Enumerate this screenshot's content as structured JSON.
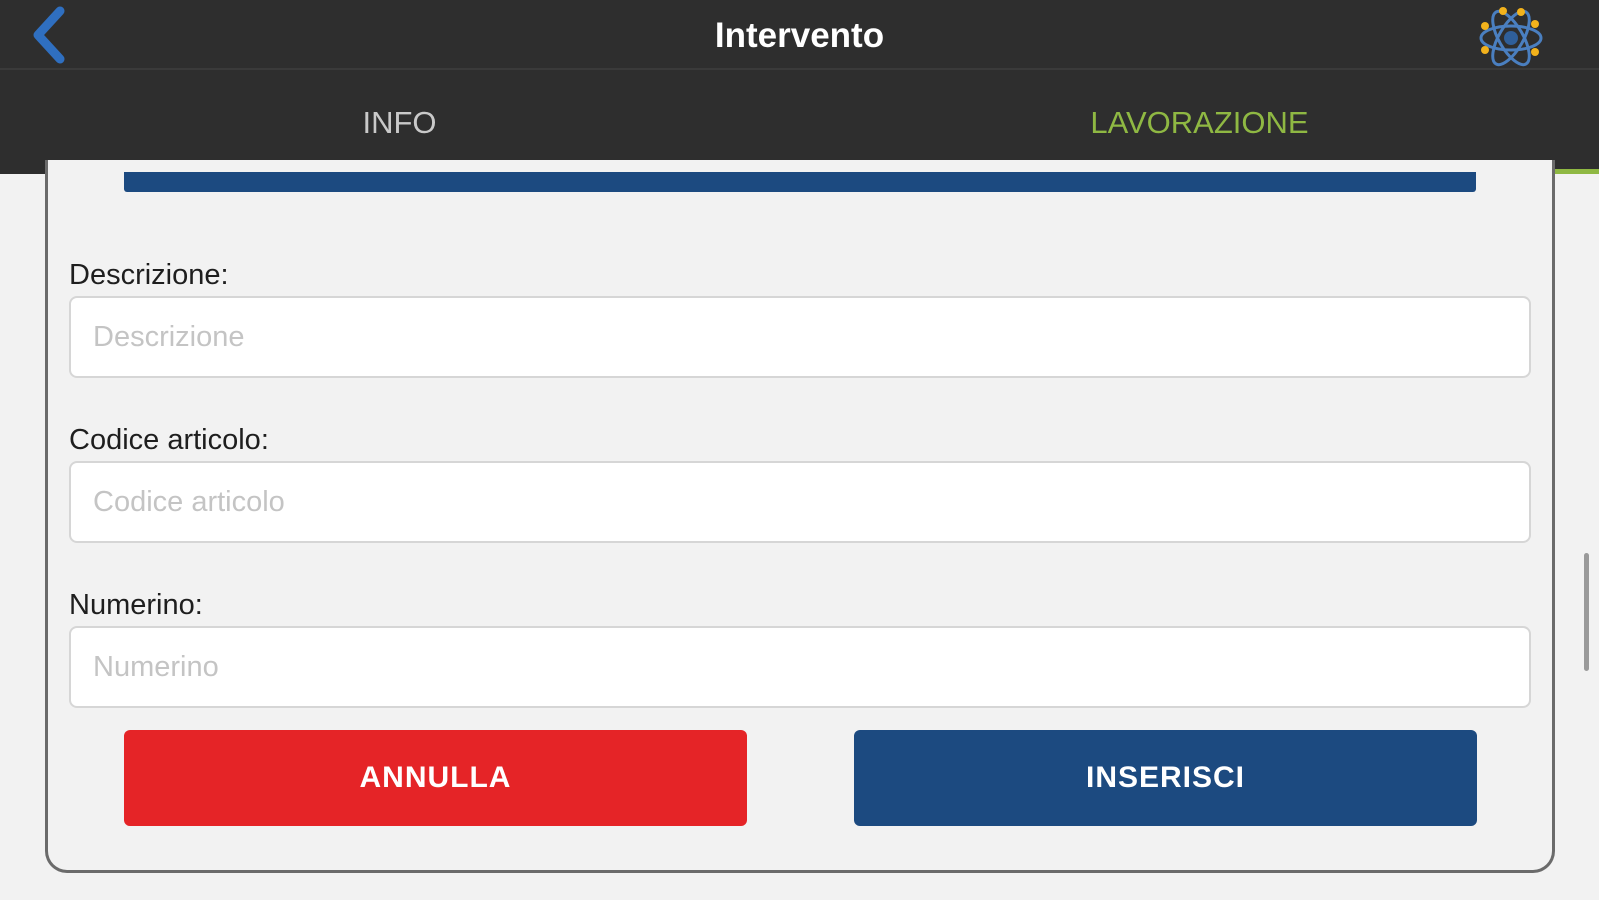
{
  "header": {
    "title": "Intervento",
    "back_icon": "chevron-left-icon",
    "logo_icon": "atom-logo-icon",
    "back_color": "#2f6fc0"
  },
  "tabs": [
    {
      "label": "INFO",
      "active": false
    },
    {
      "label": "LAVORAZIONE",
      "active": true
    }
  ],
  "form": {
    "descrizione": {
      "label": "Descrizione:",
      "placeholder": "Descrizione",
      "value": ""
    },
    "codice_articolo": {
      "label": "Codice articolo:",
      "placeholder": "Codice articolo",
      "value": ""
    },
    "numerino": {
      "label": "Numerino:",
      "placeholder": "Numerino",
      "value": ""
    }
  },
  "actions": {
    "cancel_label": "ANNULLA",
    "insert_label": "INSERISCI"
  },
  "colors": {
    "topbar_bg": "#2e2e2e",
    "tab_active": "#8fb843",
    "tab_inactive": "#c9c9c9",
    "primary_blue": "#1c4a80",
    "cancel_red": "#e52427"
  }
}
